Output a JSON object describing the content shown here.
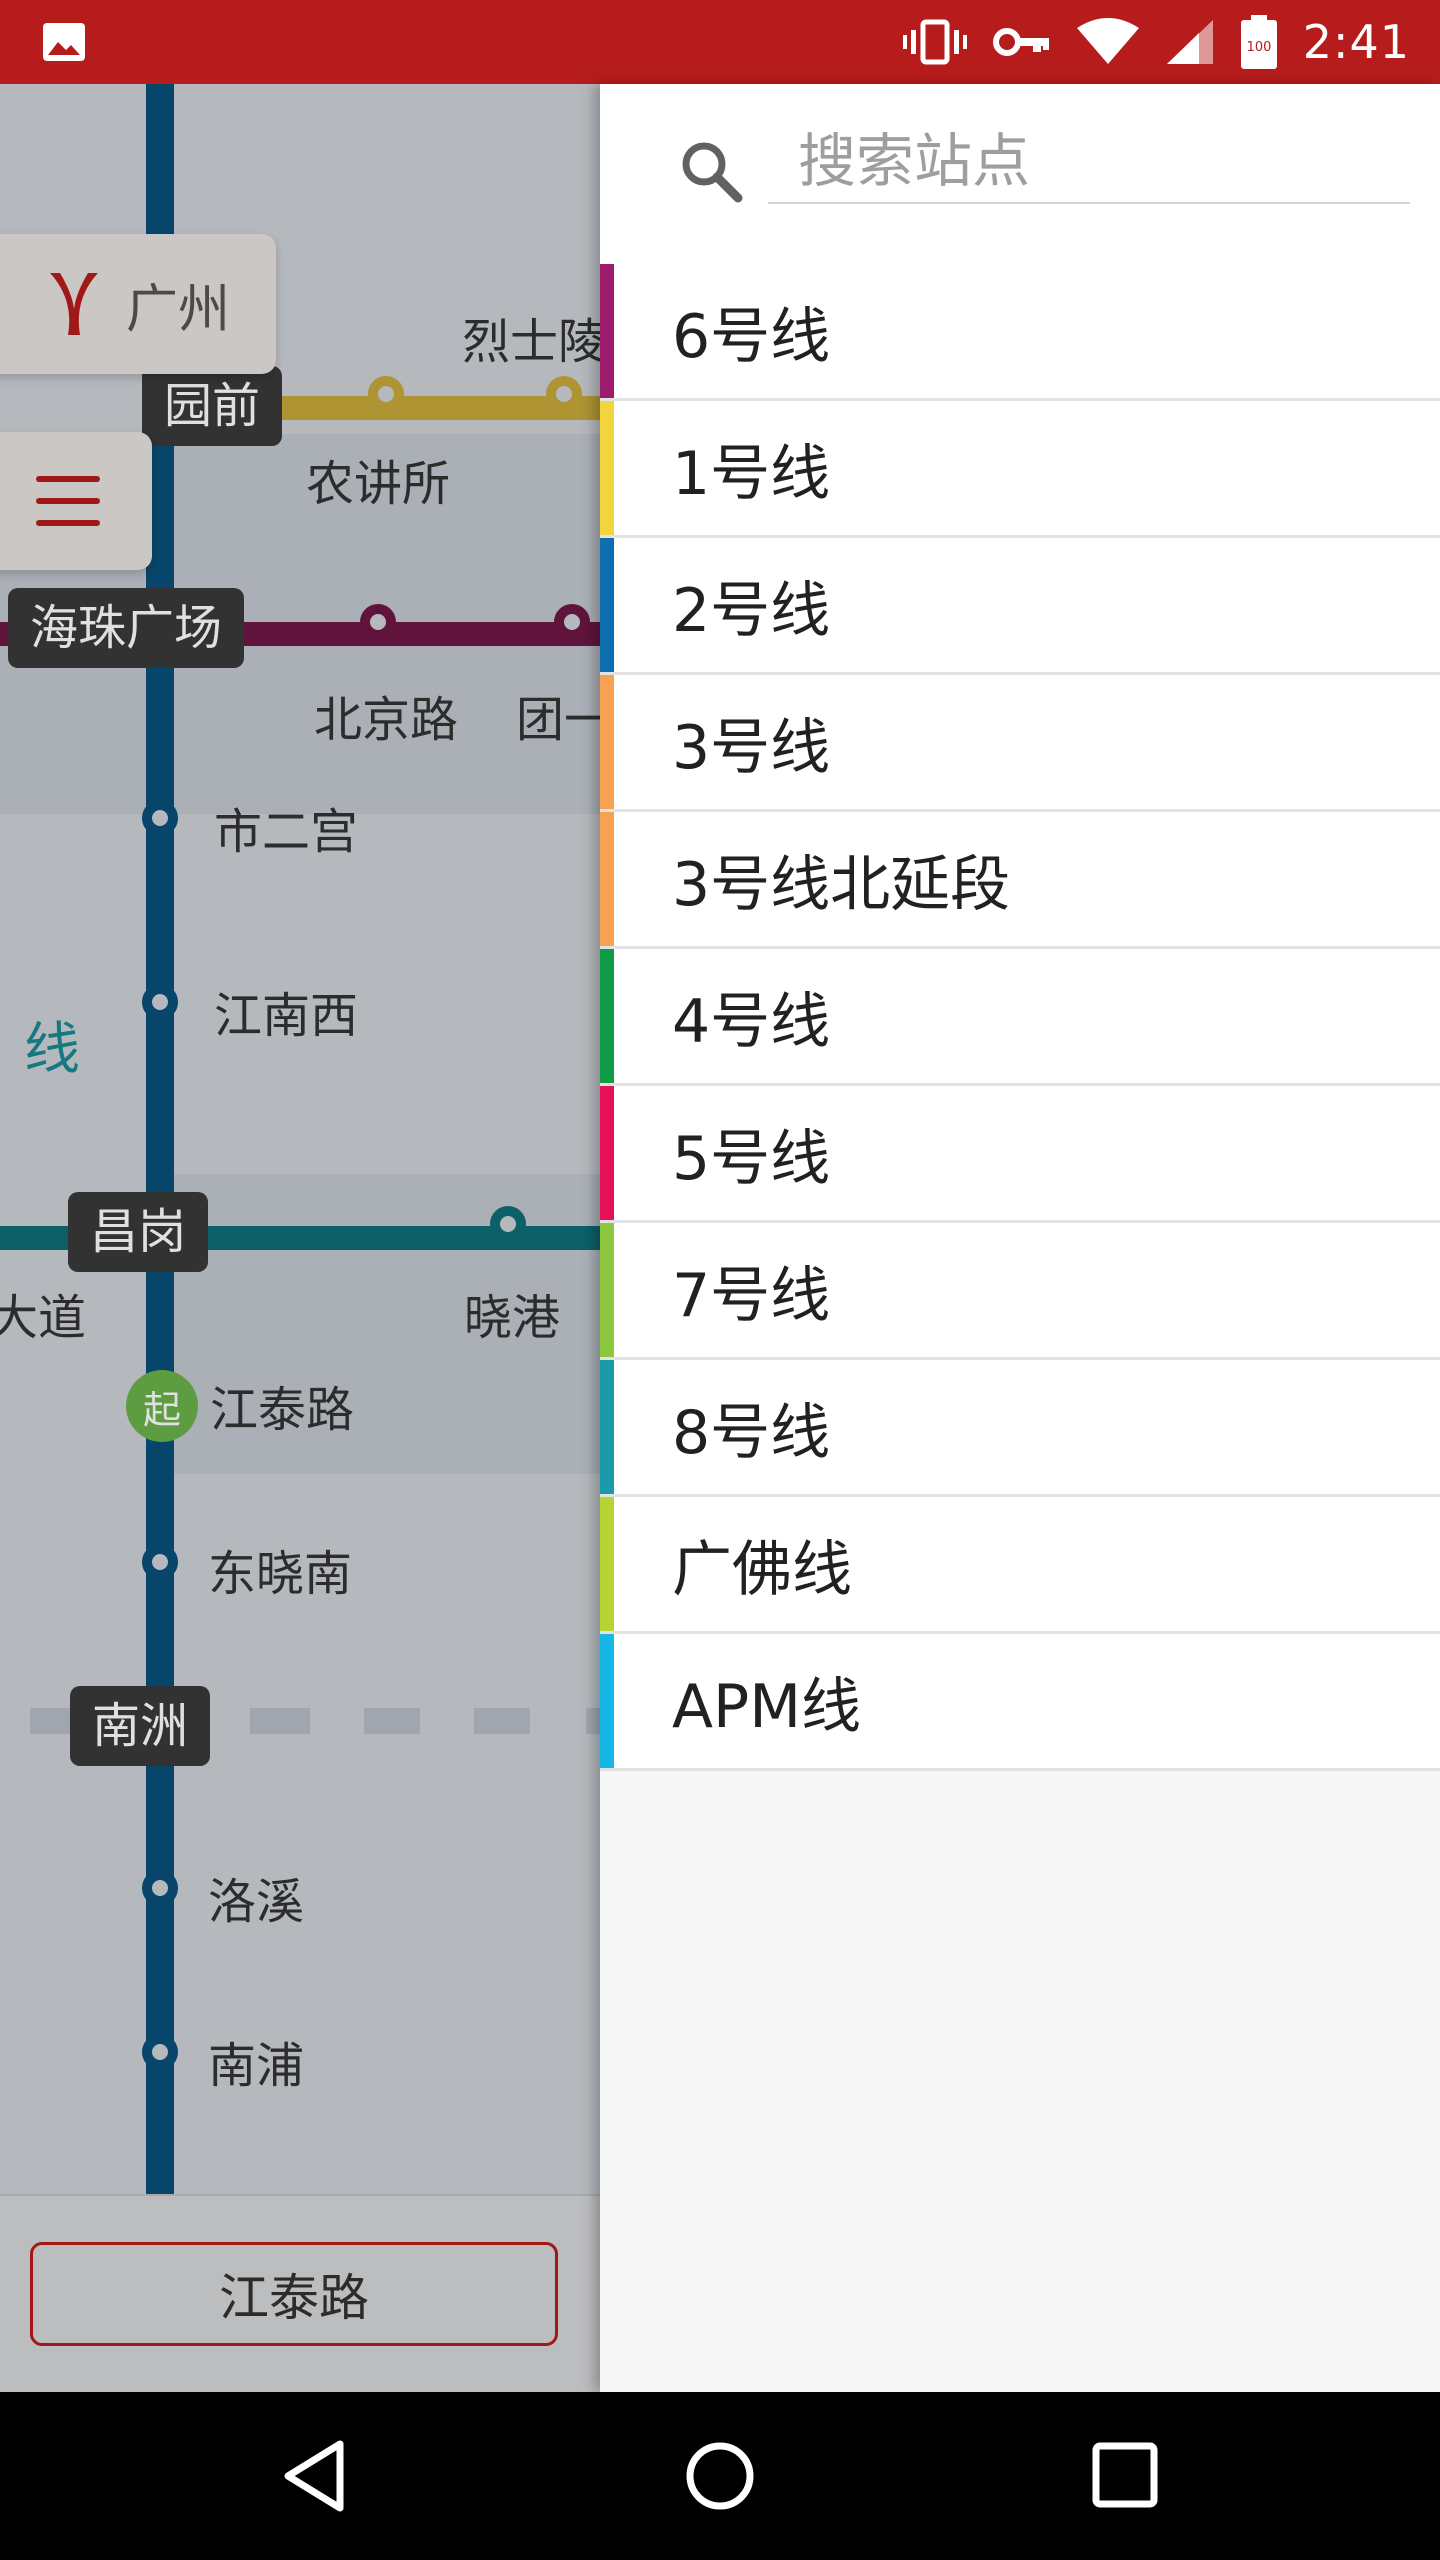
{
  "status_bar": {
    "time": "2:41",
    "battery_label": "100",
    "icons": [
      "image-icon",
      "vibrate-icon",
      "vpn-key-icon",
      "wifi-icon",
      "signal-icon",
      "battery-icon"
    ]
  },
  "map": {
    "city_name": "广州",
    "stations": {
      "lieshi": "烈士陵",
      "yuanqian": "园前",
      "nongjiangsuo": "农讲所",
      "haizhu": "海珠广场",
      "beijinglu": "北京路",
      "tuanyi": "团一",
      "shiergong": "市二宫",
      "jiangnanxi": "江南西",
      "line_label": "线",
      "changgang": "昌岗",
      "dadao": "大道",
      "xiaogang": "晓港",
      "start_badge": "起",
      "jiangtailu": "江泰路",
      "dongxiaonan": "东晓南",
      "nanzhou": "南洲",
      "luoxi": "洛溪",
      "nanpu": "南浦"
    },
    "route_start": "江泰路"
  },
  "drawer": {
    "search_placeholder": "搜索站点",
    "lines": [
      {
        "label": "6号线",
        "color": "#9c1b6d"
      },
      {
        "label": "1号线",
        "color": "#f2d43c"
      },
      {
        "label": "2号线",
        "color": "#0d6fb0"
      },
      {
        "label": "3号线",
        "color": "#f7a152"
      },
      {
        "label": "3号线北延段",
        "color": "#f7a152"
      },
      {
        "label": "4号线",
        "color": "#0e9a47"
      },
      {
        "label": "5号线",
        "color": "#e5125a"
      },
      {
        "label": "7号线",
        "color": "#8dc63f"
      },
      {
        "label": "8号线",
        "color": "#1a9aa8"
      },
      {
        "label": "广佛线",
        "color": "#b7d334"
      },
      {
        "label": "APM线",
        "color": "#16b6e6"
      }
    ]
  },
  "colors": {
    "status_bar": "#b71c1c",
    "accent": "#b71c1c",
    "line2": "#0a4f7a",
    "line1_gold": "#c8a93b",
    "line6_purple": "#6e1744",
    "line8_teal": "#0f6e76",
    "start_green": "#6bb24a"
  },
  "navigation": {
    "icons": [
      "back-icon",
      "home-icon",
      "recents-icon"
    ]
  }
}
